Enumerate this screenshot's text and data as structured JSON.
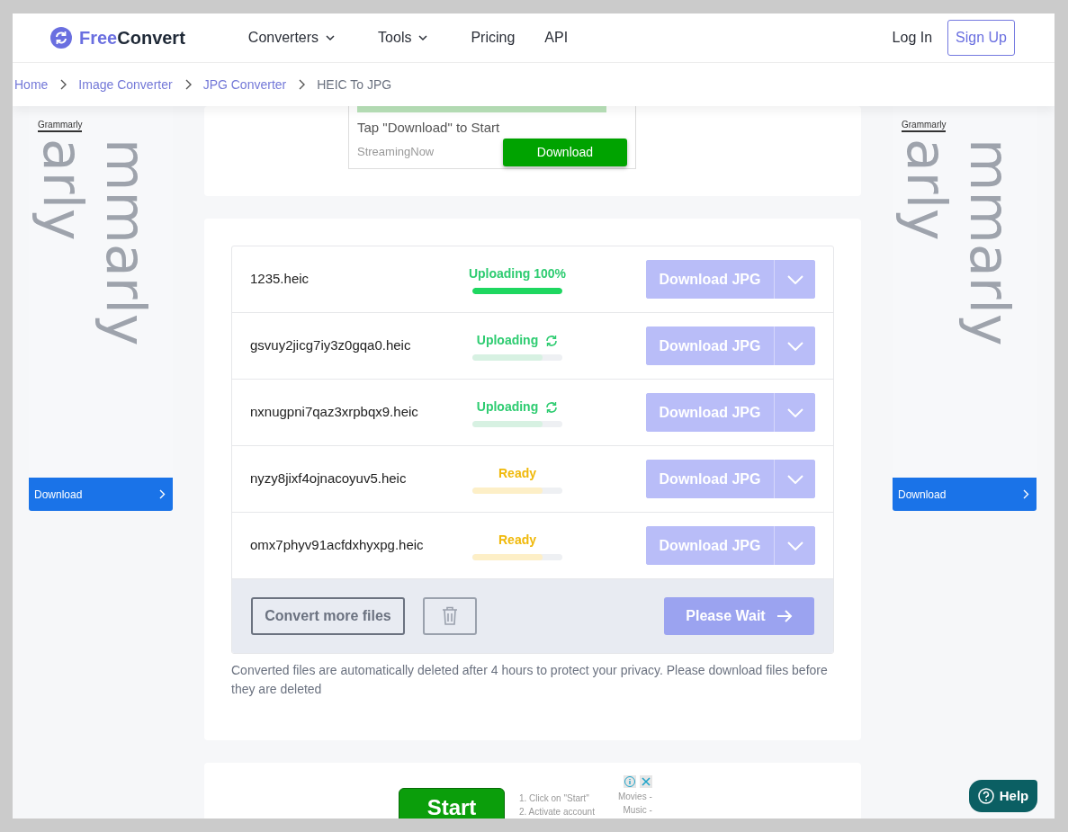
{
  "logo": {
    "part1": "Free",
    "part2": "Convert"
  },
  "nav": [
    {
      "label": "Converters",
      "dropdown": true
    },
    {
      "label": "Tools",
      "dropdown": true
    },
    {
      "label": "Pricing",
      "dropdown": false
    },
    {
      "label": "API",
      "dropdown": false
    }
  ],
  "auth": {
    "login": "Log In",
    "signup": "Sign Up"
  },
  "breadcrumb": [
    {
      "label": "Home",
      "current": false
    },
    {
      "label": "Image Converter",
      "current": false
    },
    {
      "label": "JPG Converter",
      "current": false
    },
    {
      "label": "HEIC To JPG",
      "current": true
    }
  ],
  "side_ads": [
    {
      "brand": "Grammarly",
      "wordmark_lines": [
        "mmarly",
        "arly"
      ],
      "button": "Download"
    },
    {
      "brand": "Grammarly",
      "wordmark_lines": [
        "mmarly",
        "arly"
      ],
      "button": "Download"
    }
  ],
  "top_ad": {
    "text": "Tap \"Download\" to Start",
    "source": "StreamingNow",
    "button": "Download"
  },
  "files": [
    {
      "name": "1235.heic",
      "kind": "done",
      "status": "Uploading 100%",
      "spinner": false,
      "level": 1,
      "action": "Download JPG"
    },
    {
      "name": "gsvuy2jicg7iy3z0gqa0.heic",
      "kind": "uploading",
      "status": "Uploading",
      "spinner": true,
      "level": 0.78,
      "action": "Download JPG"
    },
    {
      "name": "nxnugpni7qaz3xrpbqx9.heic",
      "kind": "uploading",
      "status": "Uploading",
      "spinner": true,
      "level": 0.78,
      "action": "Download JPG"
    },
    {
      "name": "nyzy8jixf4ojnacoyuv5.heic",
      "kind": "ready",
      "status": "Ready",
      "spinner": false,
      "level": 0.78,
      "action": "Download JPG"
    },
    {
      "name": "omx7phyv91acfdxhyxpg.heic",
      "kind": "ready",
      "status": "Ready",
      "spinner": false,
      "level": 0.78,
      "action": "Download JPG"
    }
  ],
  "footer_actions": {
    "convert_more": "Convert more files",
    "submit": "Please Wait"
  },
  "note": "Converted files are automatically deleted after 4 hours to protect your privacy. Please download files before they are deleted",
  "bottom_ad": {
    "button": "Start",
    "steps": [
      "1. Click on \"Start\"",
      "2. Activate account"
    ],
    "links": [
      "Movies -",
      "Music -"
    ]
  },
  "help": {
    "label": "Help"
  }
}
